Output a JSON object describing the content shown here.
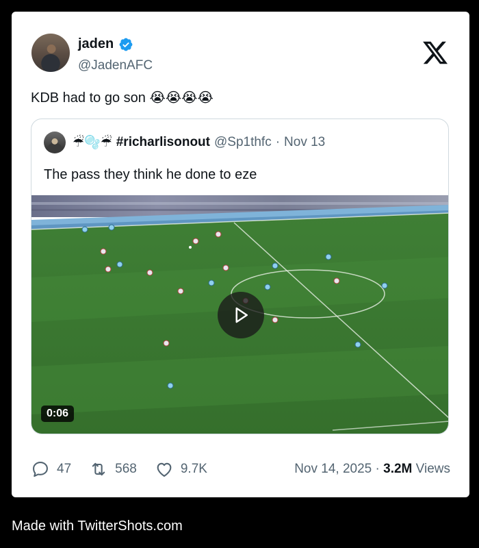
{
  "tweet": {
    "author_name": "jaden",
    "author_handle": "@JadenAFC",
    "text": "KDB had to go son 😭😭😭😭",
    "quoted": {
      "emojis": "☔🫧☔",
      "name": "#richarlisonout",
      "handle": "@Sp1thfc",
      "separator": "·",
      "date": "Nov 13",
      "text": "The pass they think he done to eze",
      "video": {
        "duration": "0:06"
      }
    },
    "stats": {
      "replies": "47",
      "retweets": "568",
      "likes": "9.7K"
    },
    "meta": {
      "date": "Nov 14, 2025",
      "separator": "·",
      "views_count": "3.2M",
      "views_label": "Views"
    }
  },
  "footer": {
    "text": "Made with TwitterShots.com"
  },
  "colors": {
    "background": "#000000",
    "card": "#ffffff",
    "verified": "#1d9bf0",
    "muted": "#536471",
    "pitch": "#3b7a33"
  }
}
